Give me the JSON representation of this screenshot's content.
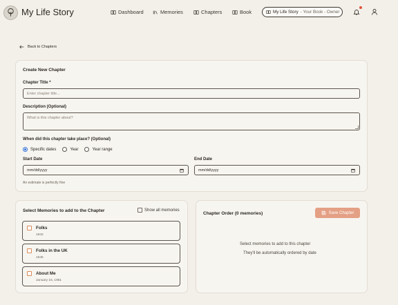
{
  "header": {
    "brand": "My Life Story",
    "nav": [
      {
        "label": "Dashboard",
        "icon": "book-icon"
      },
      {
        "label": "Memories",
        "icon": "library-icon"
      },
      {
        "label": "Chapters",
        "icon": "book-icon"
      },
      {
        "label": "Book",
        "icon": "book-icon"
      }
    ],
    "book_pill": {
      "title": "My Life Story",
      "sub": "- Your Book - Owner"
    }
  },
  "back_label": "Back to Chapters",
  "create_form": {
    "title": "Create New Chapter",
    "chapter_title_label": "Chapter Title *",
    "chapter_title_placeholder": "Enter chapter title...",
    "description_label": "Description (Optional)",
    "description_placeholder": "What is this chapter about?",
    "when_label": "When did this chapter take place? (Optional)",
    "radios": [
      {
        "label": "Specific dates",
        "selected": true
      },
      {
        "label": "Year",
        "selected": false
      },
      {
        "label": "Year range",
        "selected": false
      }
    ],
    "start_date_label": "Start Date",
    "start_date_value": "mm/dd/yyyy",
    "end_date_label": "End Date",
    "end_date_value": "mm/dd/yyyy",
    "hint": "An estimate is perfectly fine"
  },
  "memories_panel": {
    "title": "Select Memories to add to the Chapter",
    "select_all": "Show all memories",
    "items": [
      {
        "title": "Folks",
        "date": "1942"
      },
      {
        "title": "Folks in the UK",
        "date": "1945"
      },
      {
        "title": "About Me",
        "date": "January 15, 1951"
      }
    ]
  },
  "order_panel": {
    "title": "Chapter Order (0 memories)",
    "save_label": "Save Chapter",
    "empty_line1": "Select memories to add to this chapter",
    "empty_line2": "They'll be automatically ordered by date"
  },
  "colors": {
    "background": "#f3f0ea",
    "card": "#f7f5f0",
    "accent": "#e4a084",
    "radio_selected": "#2f6fd6",
    "notification": "#e0543a"
  }
}
